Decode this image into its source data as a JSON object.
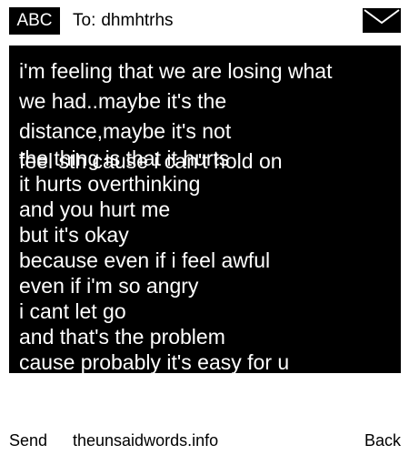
{
  "header": {
    "mode_badge": "ABC",
    "to_label": "To:",
    "recipient": "dhmhtrhs",
    "envelope_icon": "envelope-icon"
  },
  "message": {
    "overlapped_lines": [
      "i'm feeling that we are losing what",
      "we had..maybe it's the",
      "distance,maybe it's not",
      "feel sth cause i can't hold on"
    ],
    "lines": [
      "the thing is that it hurts",
      "it hurts overthinking",
      "and you hurt me",
      "but it's okay",
      "because even if i feel awful",
      "even if i'm so angry",
      "i cant let go",
      "and that's the problem",
      "cause probably it's easy for u"
    ]
  },
  "footer": {
    "send_label": "Send",
    "site_label": "theunsaidwords.info",
    "back_label": "Back"
  },
  "colors": {
    "background": "#ffffff",
    "message_bg": "#000000",
    "message_text": "#ffffff"
  }
}
